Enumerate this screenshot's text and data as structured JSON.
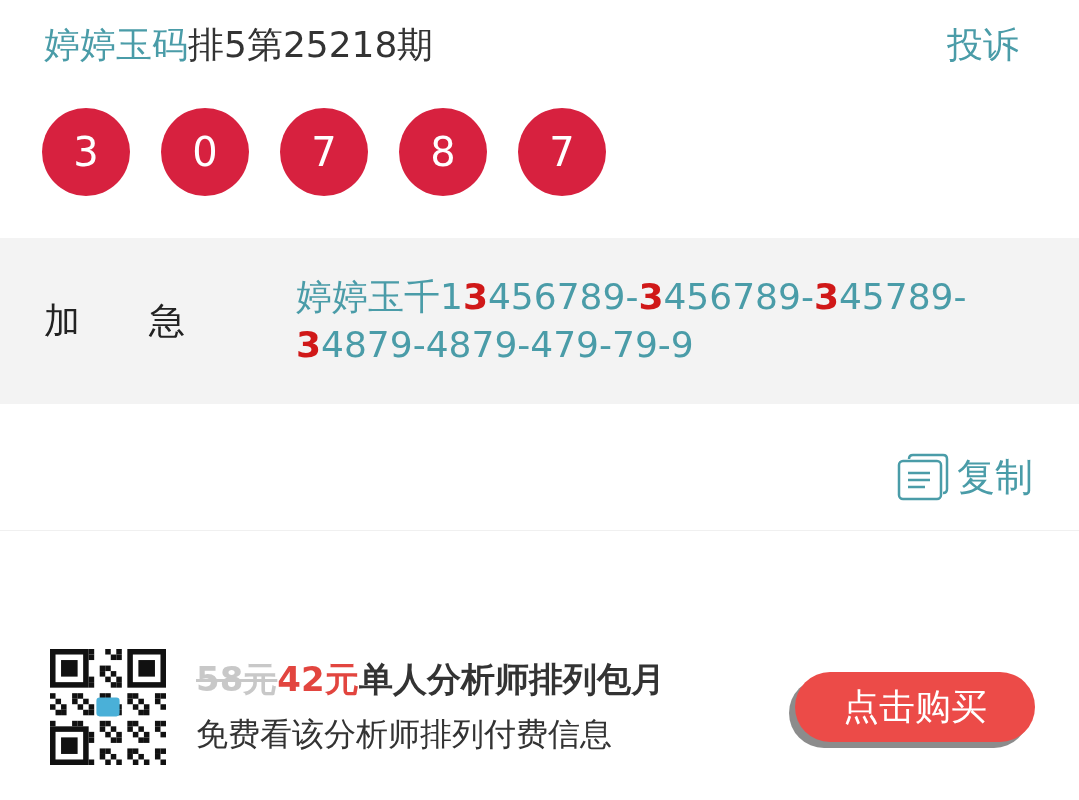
{
  "header": {
    "name": "婷婷玉码",
    "issue": "排5第25218期",
    "report_link": "投诉"
  },
  "balls": [
    "3",
    "0",
    "7",
    "8",
    "7"
  ],
  "urgent": {
    "label": "加 急",
    "content": "婷婷玉千1**3**456789-**3**456789-**3**45789-**3**4879-4879-479-79-9"
  },
  "copy_button": "复制",
  "promo": {
    "old_price": "58元",
    "new_price": "42元",
    "title": "单人分析师排列包月",
    "subtitle": "免费看该分析师排列付费信息",
    "buy_button": "点击购买"
  }
}
